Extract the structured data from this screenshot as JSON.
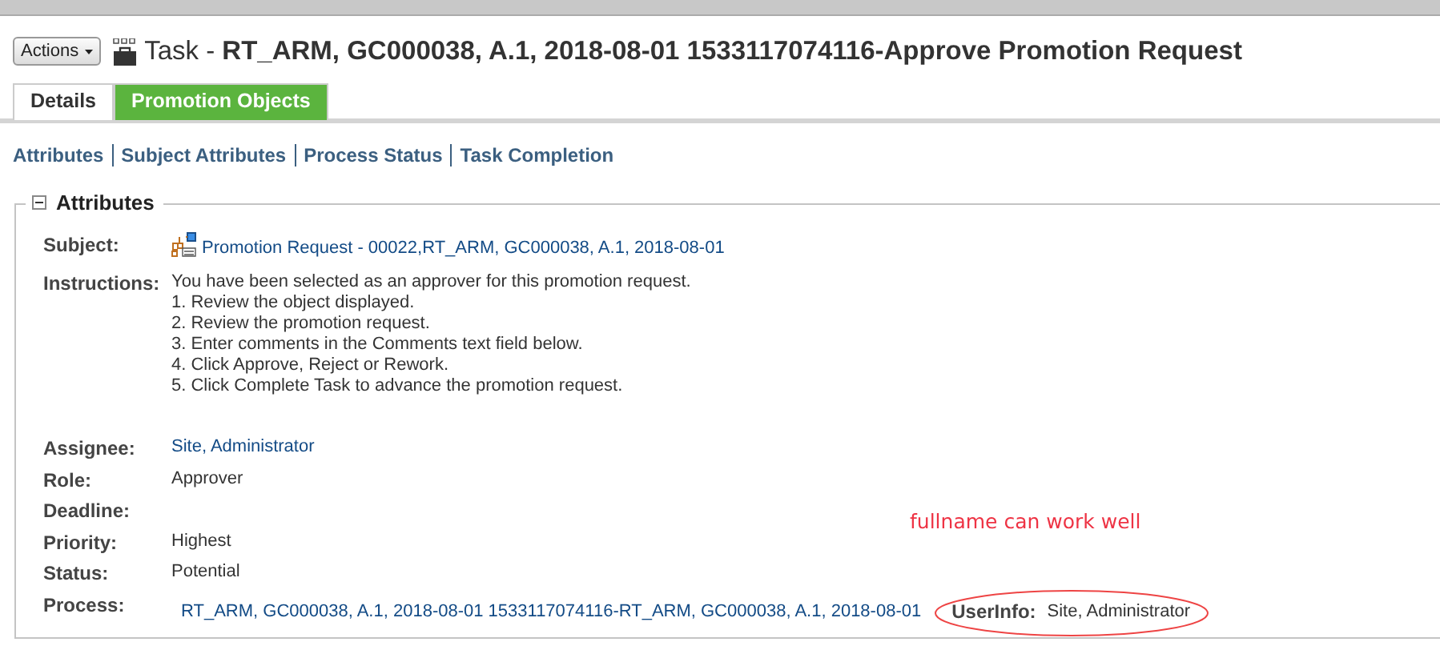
{
  "header": {
    "actions_button": "Actions",
    "title": "Task - **RT_ARM, GC000038, A.1, 2018-08-01 1533117074116-Approve Promotion Request**"
  },
  "tabs": [
    {
      "label": "Details",
      "selected": true
    },
    {
      "label": "Promotion Objects",
      "selected": false
    }
  ],
  "section_links": [
    "Attributes",
    "Subject Attributes",
    "Process Status",
    "Task Completion"
  ],
  "attributes": {
    "title": "Attributes",
    "expanded": true,
    "rows": [
      {
        "label": "Subject:",
        "kind": "subject",
        "value": "Promotion Request - 00022,RT_ARM, GC000038, A.1, 2018-08-01"
      },
      {
        "label": "Instructions:",
        "kind": "lines",
        "lines": [
          "You have been selected as an approver for this promotion request.",
          "1. Review the object displayed.",
          "2. Review the promotion request.",
          "3. Enter comments in the Comments text field below.",
          "4. Click Approve, Reject or Rework.",
          "5. Click Complete Task to advance the promotion request."
        ]
      },
      {
        "label": "Assignee:",
        "kind": "link",
        "value": "Site, Administrator"
      },
      {
        "label": "Role:",
        "kind": "text",
        "value": "Approver"
      },
      {
        "label": "Deadline:",
        "kind": "empty"
      },
      {
        "label": "Priority:",
        "kind": "text",
        "value": "Highest"
      },
      {
        "label": "Status:",
        "kind": "text",
        "value": "Potential"
      },
      {
        "label": "Process:",
        "kind": "process",
        "value": "RT_ARM, GC000038, A.1, 2018-08-01 1533117074116-RT_ARM, GC000038, A.1, 2018-08-01",
        "extra_label": "UserInfo:",
        "extra_value": "Site, Administrator"
      }
    ]
  },
  "annotation": {
    "note": "fullname can work well"
  }
}
